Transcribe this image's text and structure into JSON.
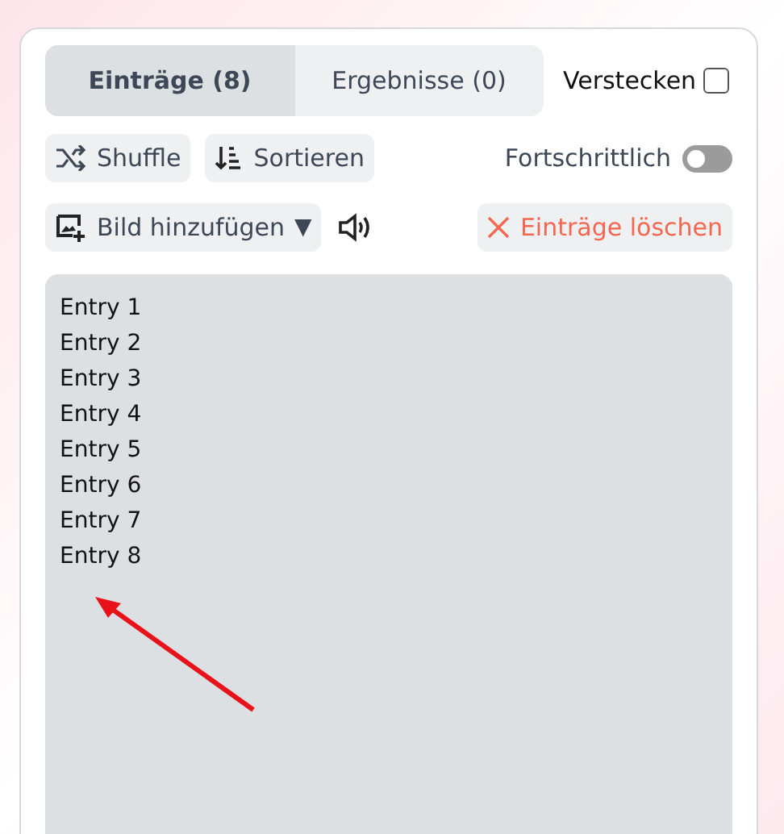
{
  "tabs": [
    {
      "label": "Einträge (8)",
      "selected": true
    },
    {
      "label": "Ergebnisse (0)",
      "selected": false
    }
  ],
  "hide": {
    "label": "Verstecken",
    "checked": false
  },
  "buttons": [
    {
      "kind": "shuffle",
      "label": "Shuffle"
    },
    {
      "kind": "sort",
      "label": "Sortieren"
    }
  ],
  "advanced": {
    "label": "Fortschrittlich",
    "on": false
  },
  "add_image": {
    "label": "Bild hinzufügen",
    "caret": "▼"
  },
  "clear": {
    "label": "Einträge löschen"
  },
  "entries": [
    "Entry 1",
    "Entry 2",
    "Entry 3",
    "Entry 4",
    "Entry 5",
    "Entry 6",
    "Entry 7",
    "Entry 8"
  ]
}
